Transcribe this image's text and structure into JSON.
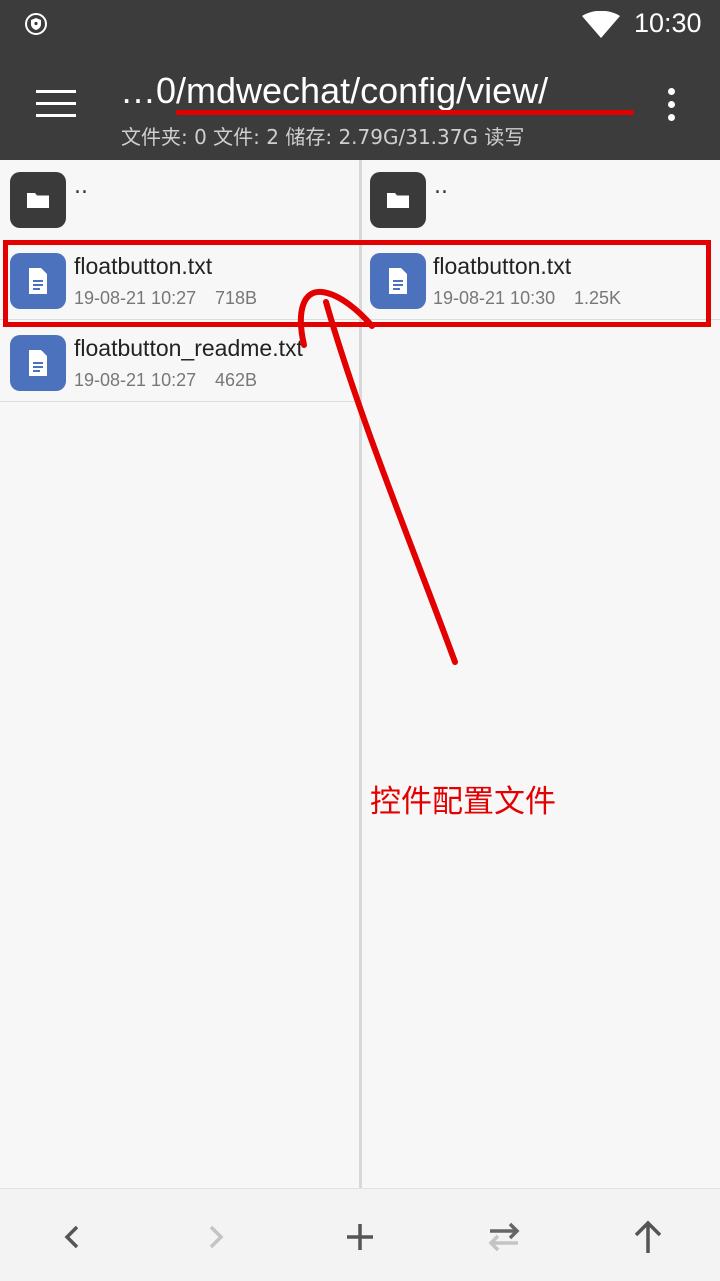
{
  "status_bar": {
    "time": "10:30"
  },
  "toolbar": {
    "path": "…0/mdwechat/config/view/",
    "info": "文件夹: 0  文件: 2  储存: 2.79G/31.37G  读写"
  },
  "left_pane": {
    "items": [
      {
        "name": "..",
        "type": "parent"
      },
      {
        "name": "floatbutton.txt",
        "date": "19-08-21 10:27",
        "size": "718B"
      },
      {
        "name": "floatbutton_readme.txt",
        "date": "19-08-21 10:27",
        "size": "462B"
      }
    ]
  },
  "right_pane": {
    "items": [
      {
        "name": "..",
        "type": "parent"
      },
      {
        "name": "floatbutton.txt",
        "date": "19-08-21 10:30",
        "size": "1.25K"
      }
    ]
  },
  "annotation": {
    "text": "控件配置文件",
    "color": "#e30000"
  },
  "colors": {
    "toolbar_bg": "#3c3c3c",
    "file_icon": "#4d72bd",
    "folder_icon": "#3a3a3a",
    "annotation_red": "#e30000"
  },
  "icons": {
    "status": [
      "shield-icon",
      "wifi-icon"
    ],
    "toolbar": [
      "hamburger-menu-icon",
      "more-vert-icon"
    ],
    "bottom": [
      "chevron-left-icon",
      "chevron-right-icon",
      "plus-icon",
      "swap-icon",
      "arrow-up-icon"
    ]
  }
}
